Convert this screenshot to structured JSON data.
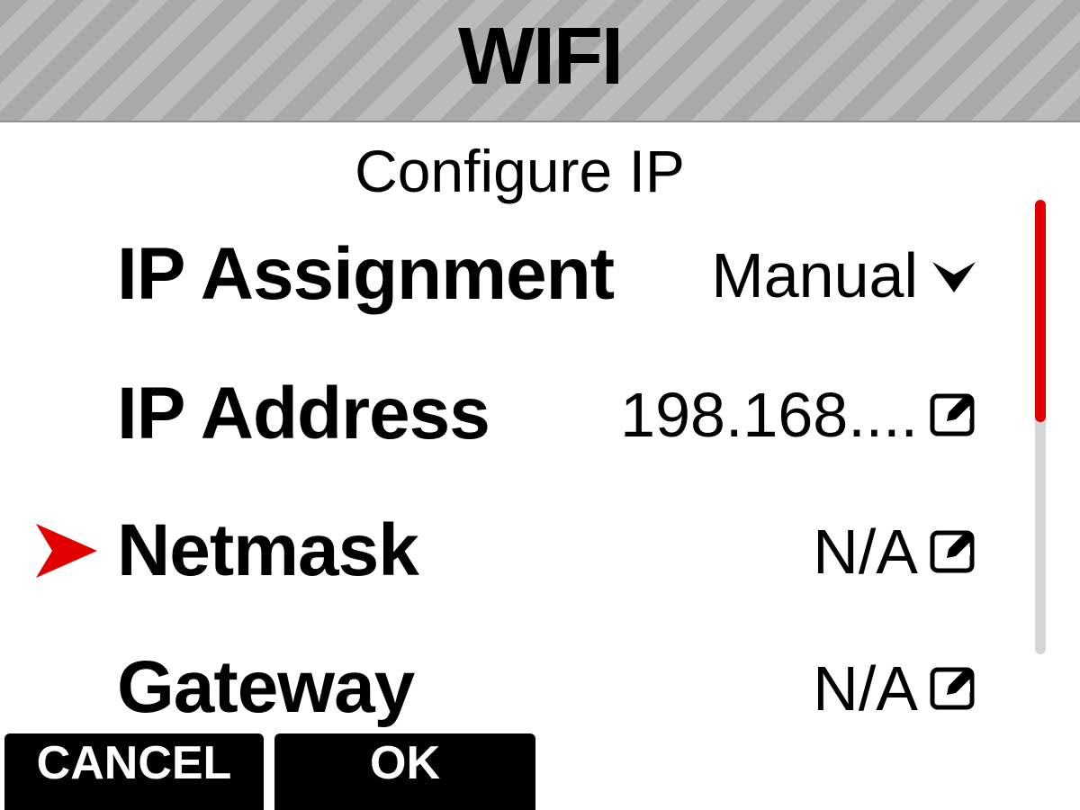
{
  "header": {
    "title": "WIFI"
  },
  "page": {
    "subtitle": "Configure IP"
  },
  "rows": [
    {
      "label": "IP Assignment",
      "value": "Manual",
      "icon": "dropdown-chevron-icon"
    },
    {
      "label": "IP Address",
      "value": "198.168....",
      "icon": "edit-icon"
    },
    {
      "label": "Netmask",
      "value": "N/A",
      "icon": "edit-icon"
    },
    {
      "label": "Gateway",
      "value": "N/A",
      "icon": "edit-icon"
    }
  ],
  "selection": {
    "selected_row": "Netmask",
    "indicator_icon": "arrow-right-icon",
    "indicator_color": "#e00000"
  },
  "scrollbar": {
    "position_fraction": 0.0,
    "visible_fraction": 0.49,
    "thumb_color": "#e00000"
  },
  "softkeys": {
    "cancel_label": "CANCEL",
    "ok_label": "OK"
  }
}
